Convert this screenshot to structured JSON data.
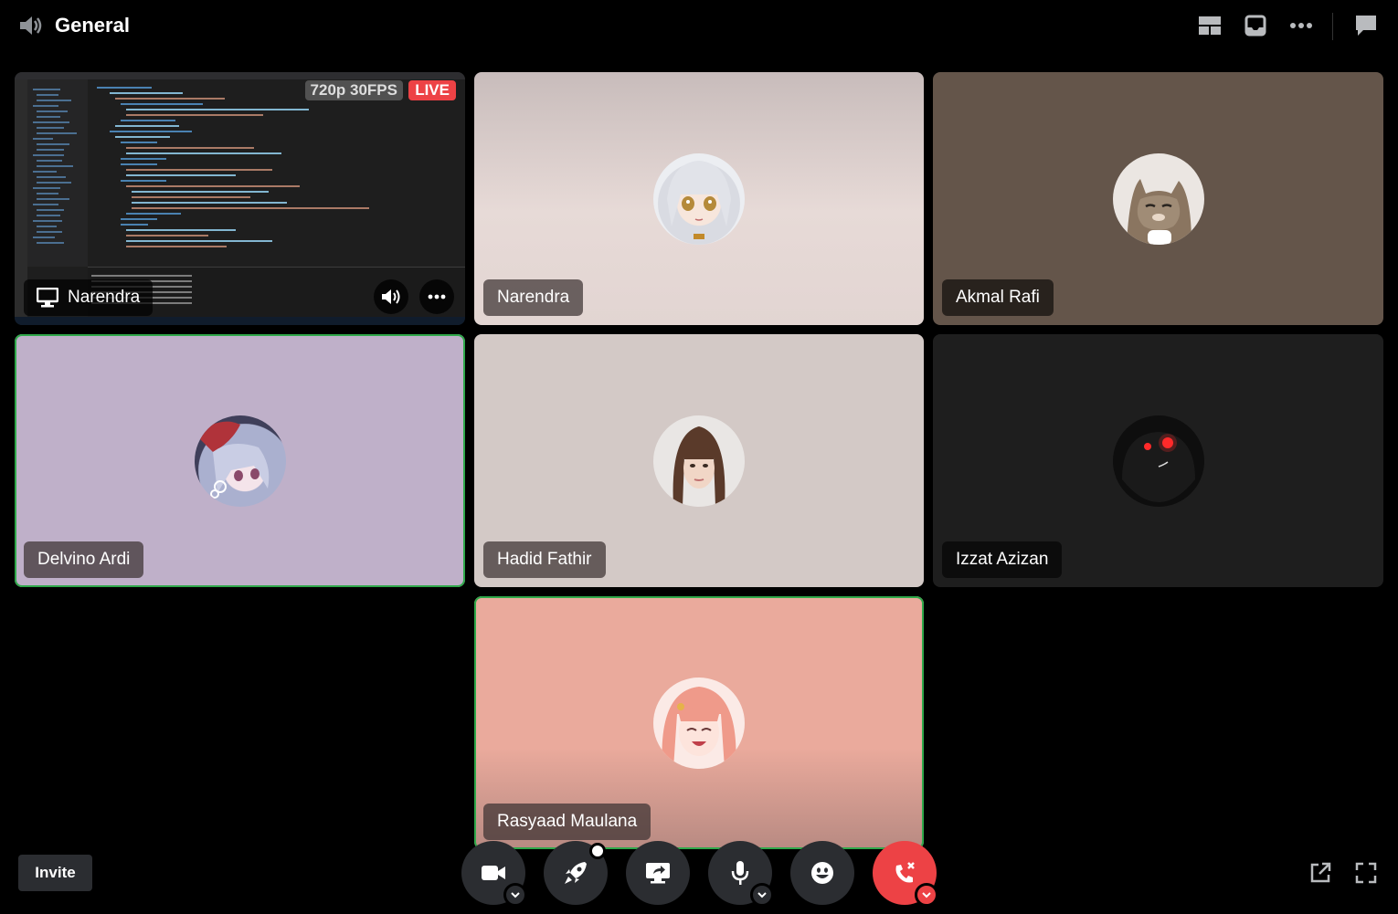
{
  "header": {
    "title": "General",
    "icons": [
      "speaker-icon",
      "grid-layout-icon",
      "inbox-icon",
      "more-icon",
      "chat-icon"
    ]
  },
  "stream": {
    "name": "Narendra",
    "quality": "720p 30FPS",
    "live": "LIVE"
  },
  "participants": [
    {
      "name": "Narendra",
      "bg": "#e3d6d3",
      "speaking": false
    },
    {
      "name": "Akmal Rafi",
      "bg": "#64554a",
      "speaking": false
    },
    {
      "name": "Delvino Ardi",
      "bg": "#bfb0c9",
      "speaking": true
    },
    {
      "name": "Hadid Fathir",
      "bg": "#d3c9c6",
      "speaking": false
    },
    {
      "name": "Izzat Azizan",
      "bg": "#1e1e1e",
      "speaking": false
    },
    {
      "name": "Rasyaad Maulana",
      "bg": "#eaaa9c",
      "speaking": true
    }
  ],
  "footer": {
    "invite_label": "Invite",
    "controls": [
      "camera-icon",
      "activity-rocket-icon",
      "screen-share-icon",
      "microphone-icon",
      "emoji-icon",
      "disconnect-icon"
    ],
    "right_icons": [
      "popout-icon",
      "fullscreen-icon"
    ]
  },
  "colors": {
    "speaking_ring": "#2fa84a",
    "danger": "#ed4245",
    "control_bg": "#2b2d31"
  }
}
